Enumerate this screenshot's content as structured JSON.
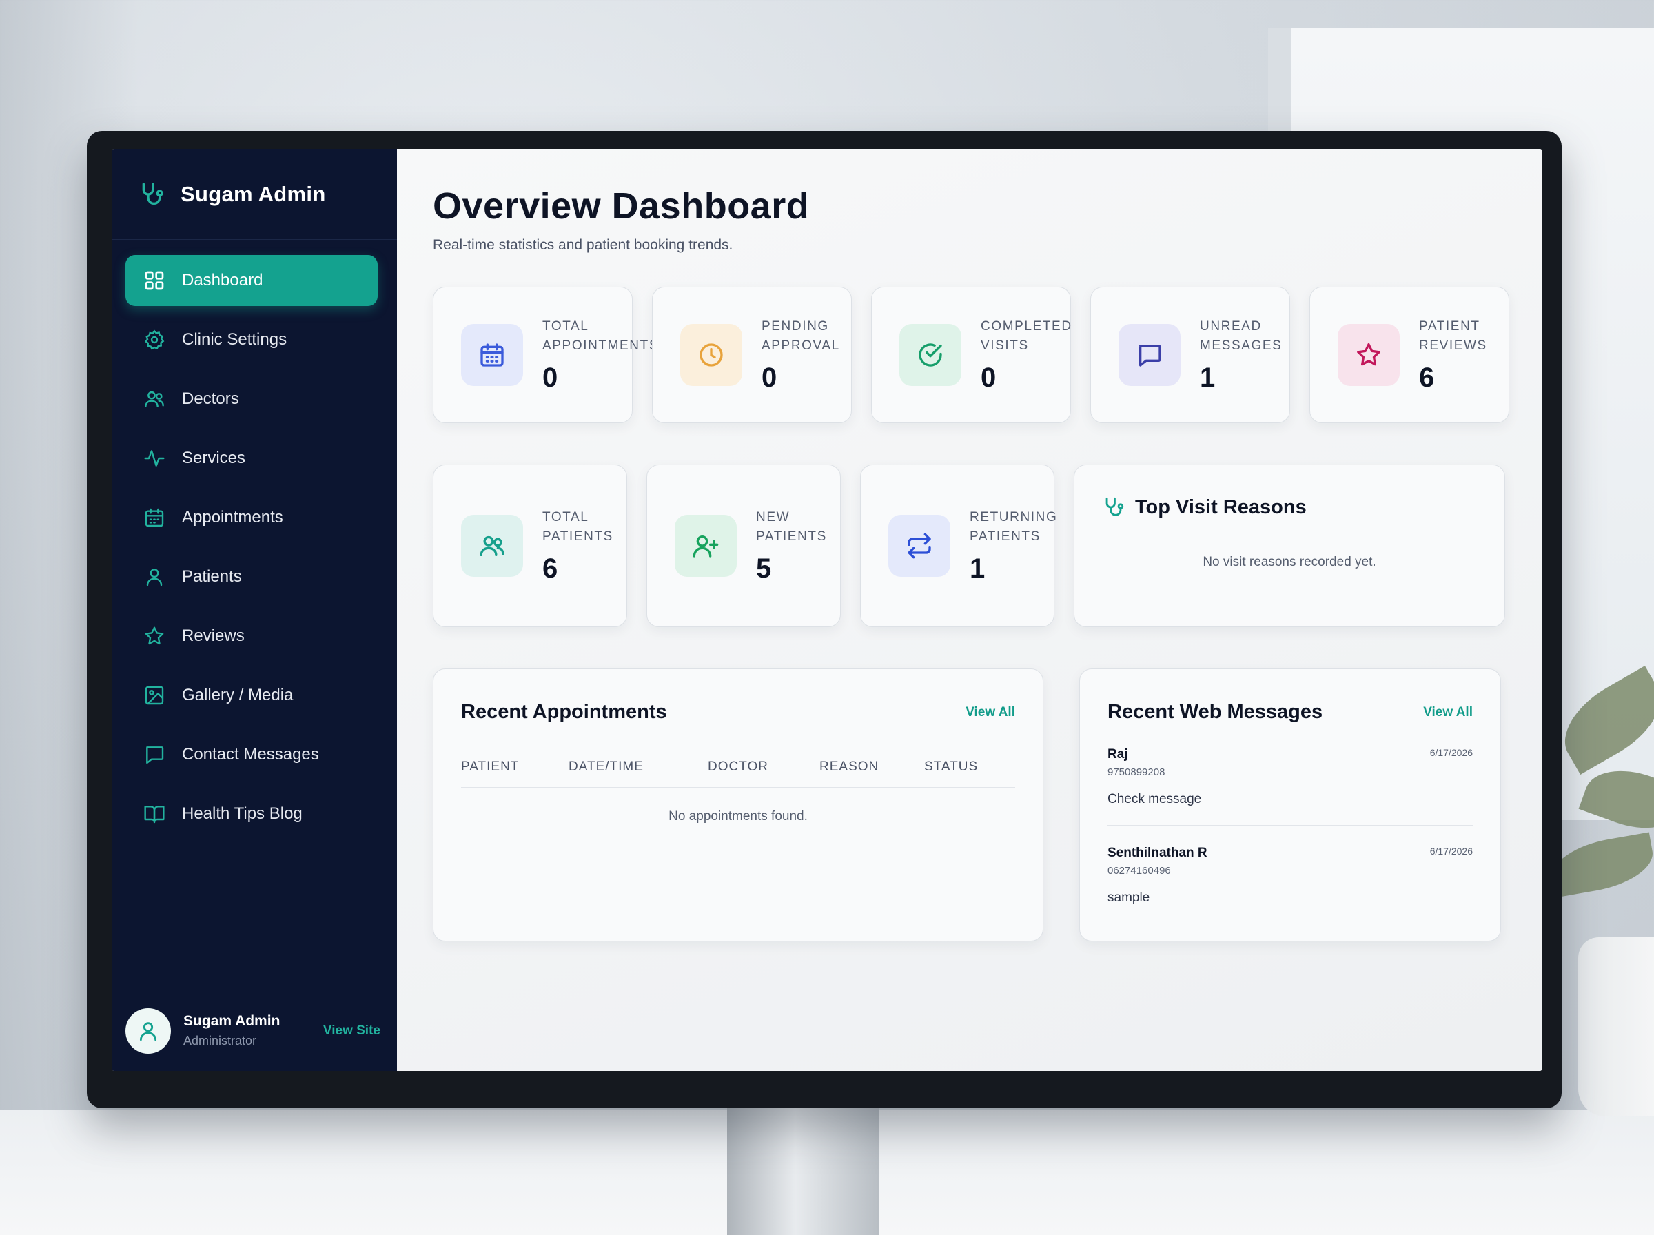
{
  "sidebar": {
    "brand": "Sugam Admin",
    "items": [
      {
        "label": "Dashboard",
        "icon": "grid-icon",
        "active": true
      },
      {
        "label": "Clinic Settings",
        "icon": "gear-icon"
      },
      {
        "label": "Dectors",
        "icon": "users-icon"
      },
      {
        "label": "Services",
        "icon": "pulse-icon"
      },
      {
        "label": "Appointments",
        "icon": "calendar-icon"
      },
      {
        "label": "Patients",
        "icon": "user-icon"
      },
      {
        "label": "Reviews",
        "icon": "star-icon"
      },
      {
        "label": "Gallery / Media",
        "icon": "image-icon"
      },
      {
        "label": "Contact Messages",
        "icon": "message-icon"
      },
      {
        "label": "Health Tips Blog",
        "icon": "book-icon"
      }
    ],
    "profile": {
      "name": "Sugam Admin",
      "role": "Administrator",
      "link": "View Site"
    }
  },
  "header": {
    "title": "Overview Dashboard",
    "subtitle": "Real-time statistics and patient booking trends."
  },
  "stats_top": [
    {
      "label": "Total Appointments",
      "value": "0",
      "icon": "calendar-icon",
      "color": "#3b5bdb",
      "bg": "#e4e9fb"
    },
    {
      "label": "Pending Approval",
      "value": "0",
      "icon": "clock-icon",
      "color": "#e8a33b",
      "bg": "#fbefdc"
    },
    {
      "label": "Completed Visits",
      "value": "0",
      "icon": "check-circle-icon",
      "color": "#169e6a",
      "bg": "#dff3e9"
    },
    {
      "label": "Unread Messages",
      "value": "1",
      "icon": "message-icon",
      "color": "#3b3fa8",
      "bg": "#e6e6f8"
    },
    {
      "label": "Patient Reviews",
      "value": "6",
      "icon": "star-icon",
      "color": "#c2185b",
      "bg": "#f8e3ec"
    }
  ],
  "stats_bottom": [
    {
      "label": "Total Patients",
      "value": "6",
      "icon": "users-icon",
      "color": "#16a08c",
      "bg": "#dff2ef"
    },
    {
      "label": "New Patients",
      "value": "5",
      "icon": "user-plus-icon",
      "color": "#17a35d",
      "bg": "#dff3e8"
    },
    {
      "label": "Returning Patients",
      "value": "1",
      "icon": "repeat-icon",
      "color": "#2c4fd6",
      "bg": "#e4e9fb"
    }
  ],
  "visit_reasons": {
    "title": "Top Visit Reasons",
    "empty": "No visit reasons recorded yet."
  },
  "recent_appointments": {
    "title": "Recent Appointments",
    "view_all": "View All",
    "columns": [
      "Patient",
      "Date/Time",
      "Doctor",
      "Reason",
      "Status"
    ],
    "empty": "No appointments found."
  },
  "recent_messages": {
    "title": "Recent Web Messages",
    "view_all": "View All",
    "items": [
      {
        "name": "Raj",
        "phone": "9750899208",
        "date": "6/17/2026",
        "body": "Check message"
      },
      {
        "name": "Senthilnathan R",
        "phone": "06274160496",
        "date": "6/17/2026",
        "body": "sample"
      }
    ]
  },
  "colors": {
    "accent": "#14a28f",
    "sidebar_bg": "#0c1530"
  }
}
